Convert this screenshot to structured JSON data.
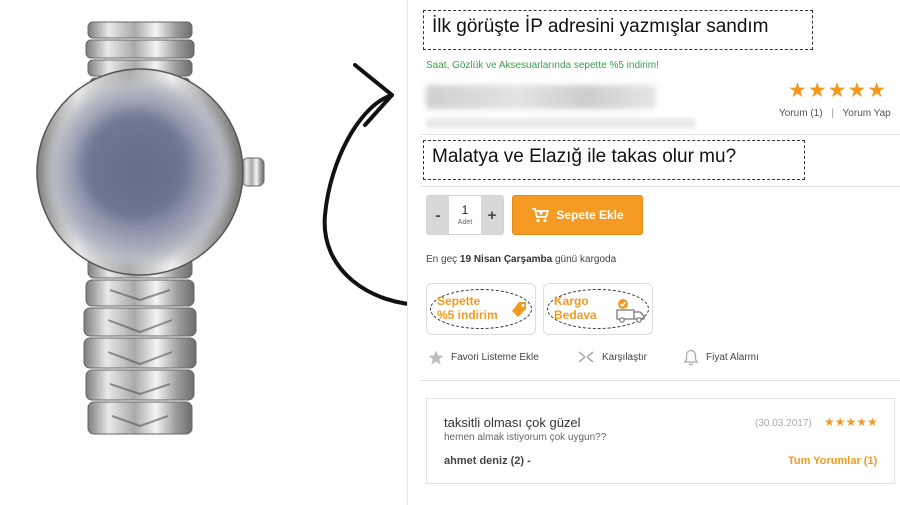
{
  "annotations": {
    "top": "İlk görüşte İP adresini yazmışlar sandım",
    "middle": "Malatya ve Elazığ ile takas olur mu?"
  },
  "product": {
    "promo_text": "Saat, Gözlük ve Aksesuarlarında sepette %5 indirim!",
    "rating_stars": "★★★★★",
    "reviews_link": "Yorum (1)",
    "review_separator": "|",
    "write_review_link": "Yorum Yap"
  },
  "purchase": {
    "minus_label": "-",
    "plus_label": "+",
    "quantity": "1",
    "quantity_unit": "Adet",
    "add_to_cart_label": "Sepete Ekle"
  },
  "delivery": {
    "prefix": "En geç",
    "date": "19 Nisan Çarşamba",
    "suffix": "günü kargoda"
  },
  "badges": {
    "discount": {
      "line1": "Sepette",
      "line2": "%5 indirim",
      "icon": "price-tag-icon"
    },
    "shipping": {
      "line1": "Kargo",
      "line2": "Bedava",
      "icon": "truck-icon"
    }
  },
  "actions": {
    "favorite": "Favori Listeme Ekle",
    "compare": "Karşılaştır",
    "price_alarm": "Fiyat Alarmı"
  },
  "review": {
    "title": "taksitli olması çok güzel",
    "date": "(30.03.2017)",
    "stars": "★★★★★",
    "body": "hemen almak istiyorum çok uygun??",
    "author": "ahmet deniz (2) -",
    "all_reviews_link": "Tum Yorumlar (1)"
  },
  "colors": {
    "accent": "#f59a22",
    "promo_green": "#3aa14a"
  }
}
